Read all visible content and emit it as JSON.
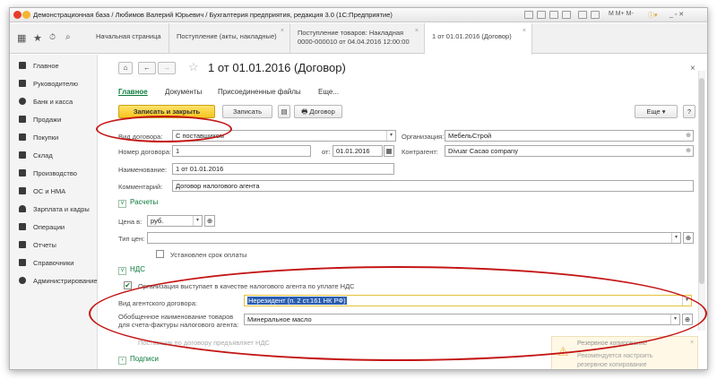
{
  "window": {
    "title": "Демонстрационная база / Любимов Валерий Юрьевич / Бухгалтерия предприятия, редакция 3.0  (1С:Предприятие)",
    "toolbar_right": "M  M+  M-",
    "window_controls": "_ ▫ ✕"
  },
  "tabs": [
    {
      "label": "Начальная страница"
    },
    {
      "label": "Поступление (акты, накладные)"
    },
    {
      "label_line1": "Поступление товаров: Накладная",
      "label_line2": "0000-000010 от 04.04.2016 12:00:00"
    },
    {
      "label": "1 от 01.01.2016 (Договор)"
    }
  ],
  "sidebar": {
    "items": [
      {
        "label": "Главное",
        "icon": "menu-icon"
      },
      {
        "label": "Руководителю",
        "icon": "trend-icon"
      },
      {
        "label": "Банк и касса",
        "icon": "coin-icon"
      },
      {
        "label": "Продажи",
        "icon": "bag-icon"
      },
      {
        "label": "Покупки",
        "icon": "cart-icon"
      },
      {
        "label": "Склад",
        "icon": "warehouse-icon"
      },
      {
        "label": "Производство",
        "icon": "factory-icon"
      },
      {
        "label": "ОС и НМА",
        "icon": "truck-icon"
      },
      {
        "label": "Зарплата и кадры",
        "icon": "person-icon"
      },
      {
        "label": "Операции",
        "icon": "operations-icon"
      },
      {
        "label": "Отчеты",
        "icon": "chart-icon"
      },
      {
        "label": "Справочники",
        "icon": "book-icon"
      },
      {
        "label": "Администрирование",
        "icon": "gear-icon"
      }
    ]
  },
  "document": {
    "title": "1 от 01.01.2016 (Договор)",
    "subnav": [
      "Главное",
      "Документы",
      "Присоединенные файлы",
      "Еще..."
    ],
    "buttons": {
      "save_close": "Записать и закрыть",
      "save": "Записать",
      "contract": "Договор",
      "more": "Еще",
      "help": "?"
    },
    "fields": {
      "contract_type_label": "Вид договора:",
      "contract_type_value": "С поставщиком",
      "organization_label": "Организация:",
      "organization_value": "МебельСтрой",
      "number_label": "Номер договора:",
      "number_value": "1",
      "date_from_label": "от:",
      "date_value": "01.01.2016",
      "counterparty_label": "Контрагент:",
      "counterparty_value": "Divuar Cacao company",
      "name_label": "Наименование:",
      "name_value": "1 от 01.01.2016",
      "comment_label": "Комментарий:",
      "comment_value": "Договор налогового агента"
    },
    "settlements": {
      "section_label": "Расчеты",
      "price_label": "Цена в:",
      "price_value": "руб.",
      "price_type_label": "Тип цен:",
      "price_type_value": "",
      "payment_term_label": "Установлен срок оплаты"
    },
    "vat": {
      "section_label": "НДС",
      "tax_agent_label": "Организация выступает в качестве налогового агента по уплате НДС",
      "agent_contract_type_label": "Вид агентского договора:",
      "agent_contract_type_value": "Нерезидент (п. 2 ст.161 НК РФ)",
      "goods_name_label_line1": "Обобщенное наименование товаров",
      "goods_name_label_line2": "для счета-фактуры налогового агента:",
      "goods_name_value": "Минеральное масло",
      "supplier_vat_label": "Поставщик по договору предъявляет НДС"
    },
    "signatures_section": "Подписи"
  },
  "notification": {
    "line1": "Резервное копирование",
    "line2": "Рекомендуется настроить",
    "line3": "резервное копирование"
  },
  "colors": {
    "accent_green": "#0a7a3a",
    "primary_button": "#f7c51e",
    "annotation_red": "#c41515",
    "selection_blue": "#2a5db0"
  }
}
